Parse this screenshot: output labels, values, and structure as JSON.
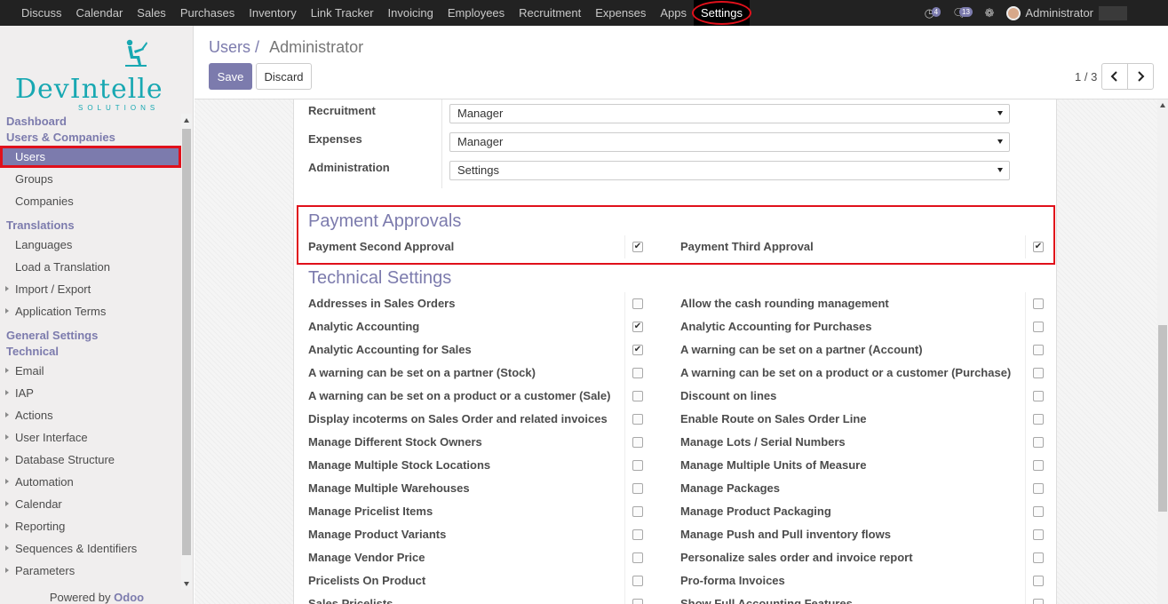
{
  "topnav": {
    "items": [
      "Discuss",
      "Calendar",
      "Sales",
      "Purchases",
      "Inventory",
      "Link Tracker",
      "Invoicing",
      "Employees",
      "Recruitment",
      "Expenses",
      "Apps",
      "Settings"
    ],
    "active": "Settings",
    "activity_badge": "4",
    "messages_badge": "13",
    "user": "Administrator"
  },
  "sidebar": {
    "logo_brand": "DevIntelle",
    "logo_sub": "SOLUTIONS",
    "sections": [
      {
        "header": "Dashboard",
        "items": []
      },
      {
        "header": "Users & Companies",
        "items": [
          {
            "label": "Users",
            "active": true,
            "caret": false
          },
          {
            "label": "Groups",
            "caret": false
          },
          {
            "label": "Companies",
            "caret": false
          }
        ]
      },
      {
        "header": "Translations",
        "items": [
          {
            "label": "Languages",
            "caret": false
          },
          {
            "label": "Load a Translation",
            "caret": false
          },
          {
            "label": "Import / Export",
            "caret": true
          },
          {
            "label": "Application Terms",
            "caret": true
          }
        ]
      },
      {
        "header": "General Settings",
        "items": []
      },
      {
        "header": "Technical",
        "items": [
          {
            "label": "Email",
            "caret": true
          },
          {
            "label": "IAP",
            "caret": true
          },
          {
            "label": "Actions",
            "caret": true
          },
          {
            "label": "User Interface",
            "caret": true
          },
          {
            "label": "Database Structure",
            "caret": true
          },
          {
            "label": "Automation",
            "caret": true
          },
          {
            "label": "Calendar",
            "caret": true
          },
          {
            "label": "Reporting",
            "caret": true
          },
          {
            "label": "Sequences & Identifiers",
            "caret": true
          },
          {
            "label": "Parameters",
            "caret": true
          }
        ]
      }
    ],
    "powered_prefix": "Powered by",
    "powered_brand": "Odoo"
  },
  "control": {
    "breadcrumb_parent": "Users",
    "breadcrumb_sep": "/",
    "breadcrumb_current": "Administrator",
    "save_label": "Save",
    "discard_label": "Discard",
    "pager": "1 / 3"
  },
  "access_rights": [
    {
      "label": "Recruitment",
      "value": "Manager"
    },
    {
      "label": "Expenses",
      "value": "Manager"
    },
    {
      "label": "Administration",
      "value": "Settings"
    }
  ],
  "payment_approvals": {
    "title": "Payment Approvals",
    "rows": [
      {
        "left": "Payment Second Approval",
        "left_checked": true,
        "right": "Payment Third Approval",
        "right_checked": true
      }
    ]
  },
  "technical_settings": {
    "title": "Technical Settings",
    "rows": [
      {
        "left": "Addresses in Sales Orders",
        "left_checked": false,
        "right": "Allow the cash rounding management",
        "right_checked": false
      },
      {
        "left": "Analytic Accounting",
        "left_checked": true,
        "right": "Analytic Accounting for Purchases",
        "right_checked": false
      },
      {
        "left": "Analytic Accounting for Sales",
        "left_checked": true,
        "right": "A warning can be set on a partner (Account)",
        "right_checked": false
      },
      {
        "left": "A warning can be set on a partner (Stock)",
        "left_checked": false,
        "right": "A warning can be set on a product or a customer (Purchase)",
        "right_checked": false
      },
      {
        "left": "A warning can be set on a product or a customer (Sale)",
        "left_checked": false,
        "right": "Discount on lines",
        "right_checked": false
      },
      {
        "left": "Display incoterms on Sales Order and related invoices",
        "left_checked": false,
        "right": "Enable Route on Sales Order Line",
        "right_checked": false
      },
      {
        "left": "Manage Different Stock Owners",
        "left_checked": false,
        "right": "Manage Lots / Serial Numbers",
        "right_checked": false
      },
      {
        "left": "Manage Multiple Stock Locations",
        "left_checked": false,
        "right": "Manage Multiple Units of Measure",
        "right_checked": false
      },
      {
        "left": "Manage Multiple Warehouses",
        "left_checked": false,
        "right": "Manage Packages",
        "right_checked": false
      },
      {
        "left": "Manage Pricelist Items",
        "left_checked": false,
        "right": "Manage Product Packaging",
        "right_checked": false
      },
      {
        "left": "Manage Product Variants",
        "left_checked": false,
        "right": "Manage Push and Pull inventory flows",
        "right_checked": false
      },
      {
        "left": "Manage Vendor Price",
        "left_checked": false,
        "right": "Personalize sales order and invoice report",
        "right_checked": false
      },
      {
        "left": "Pricelists On Product",
        "left_checked": false,
        "right": "Pro-forma Invoices",
        "right_checked": false
      },
      {
        "left": "Sales Pricelists",
        "left_checked": false,
        "right": "Show Full Accounting Features",
        "right_checked": false
      }
    ]
  },
  "colors": {
    "accent": "#7c7bad",
    "highlight": "#e0101b",
    "topbar": "#222222"
  }
}
